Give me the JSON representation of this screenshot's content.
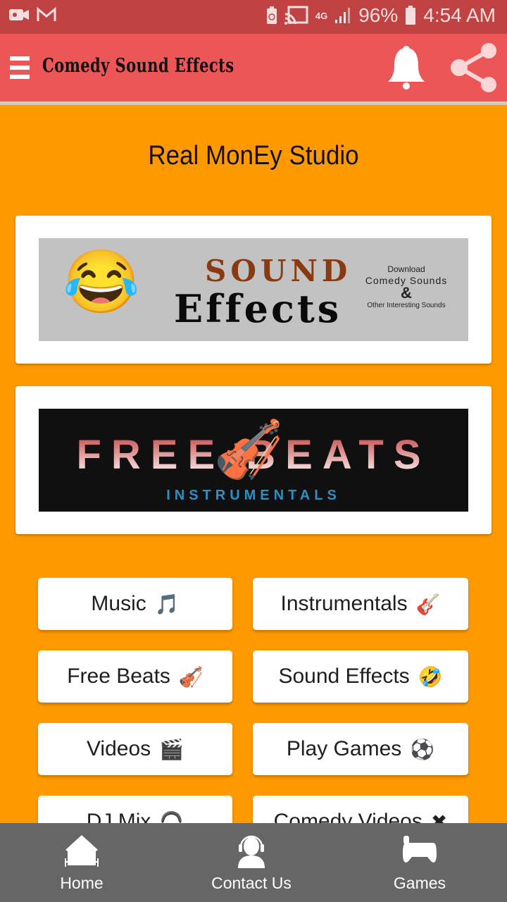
{
  "status_bar": {
    "left_icons": [
      "video-camera-icon",
      "gmail-icon"
    ],
    "right_icons": [
      "battery-saver-icon",
      "cast-icon",
      "network-4g-icon",
      "signal-icon",
      "battery-icon"
    ],
    "network": "4G",
    "battery": "96%",
    "time": "4:54 AM"
  },
  "app_bar": {
    "title": "Comedy Sound Effects",
    "menu_icon": "hamburger-menu-icon",
    "actions": [
      "bell-icon",
      "share-icon"
    ]
  },
  "main": {
    "heading": "Real MonEy Studio",
    "banners": [
      {
        "name": "sound-effects-banner",
        "emoji": "😂",
        "title_top": "SOUND",
        "title_bottom": "Effects",
        "side_line1": "Download",
        "side_line2": "Comedy Sounds",
        "side_amp": "&",
        "side_line3": "Other Interesting Sounds"
      },
      {
        "name": "free-beats-banner",
        "title": "FREE BEATS",
        "emoji": "🎻",
        "subtitle": "INSTRUMENTALS"
      }
    ],
    "buttons": [
      {
        "label": "Music",
        "emoji": "🎵"
      },
      {
        "label": "Instrumentals",
        "emoji": "🎸"
      },
      {
        "label": "Free Beats",
        "emoji": "🎻"
      },
      {
        "label": "Sound Effects",
        "emoji": "🤣"
      },
      {
        "label": "Videos",
        "emoji": "🎬"
      },
      {
        "label": "Play Games",
        "emoji": "⚽"
      },
      {
        "label": "DJ Mix",
        "emoji": "🎧"
      },
      {
        "label": "Comedy Videos",
        "emoji": "✖"
      }
    ]
  },
  "bottom_nav": {
    "items": [
      {
        "label": "Home",
        "icon": "home-icon"
      },
      {
        "label": "Contact Us",
        "icon": "headset-user-icon"
      },
      {
        "label": "Games",
        "icon": "gamepad-icon"
      }
    ]
  },
  "colors": {
    "status_bar": "#c04242",
    "app_bar": "#ec5656",
    "background": "#ff9900",
    "bottom_nav": "#666666",
    "card": "#ffffff"
  }
}
